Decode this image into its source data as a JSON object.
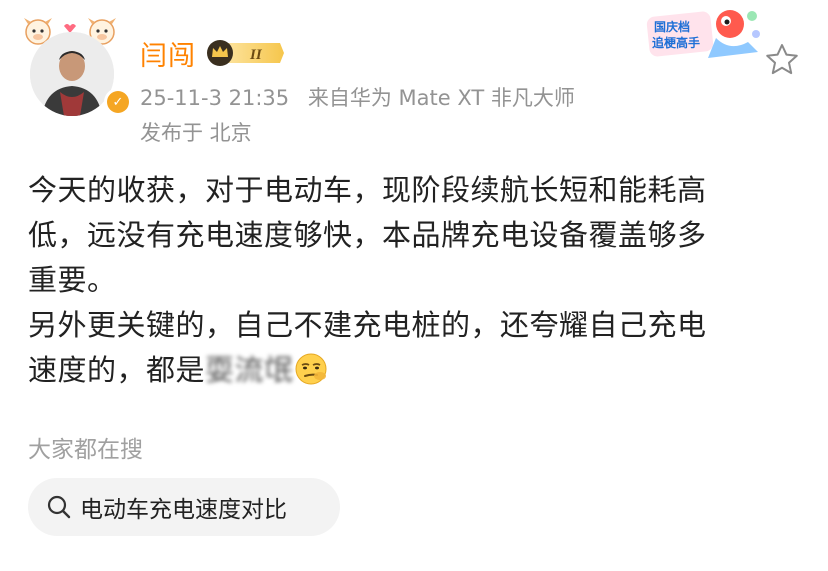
{
  "author": {
    "name": "闫闯",
    "level_badge": "II",
    "verified_icon": "verified-v-icon"
  },
  "meta": {
    "timestamp": "25-11-3 21:35",
    "source": "来自华为 Mate XT 非凡大师",
    "location": "发布于 北京"
  },
  "sticker": {
    "text_line1": "国庆档",
    "text_line2": "追梗高手"
  },
  "post": {
    "lines": [
      "今天的收获，对于电动车，现阶段续航长短和能耗高",
      "低，远没有充电速度够快，本品牌充电设备覆盖够多",
      "重要。",
      "另外更关键的，自己不建充电桩的，还夸耀自己充电"
    ],
    "last_line_prefix": "速度的，都是",
    "last_line_blurred": "耍流氓",
    "last_line_emoji": "smirk-emoji"
  },
  "hot_search": {
    "label": "大家都在搜",
    "query": "电动车充电速度对比"
  },
  "colors": {
    "username": "#ff8200",
    "meta": "#939393",
    "chip_bg": "#f3f3f3"
  }
}
